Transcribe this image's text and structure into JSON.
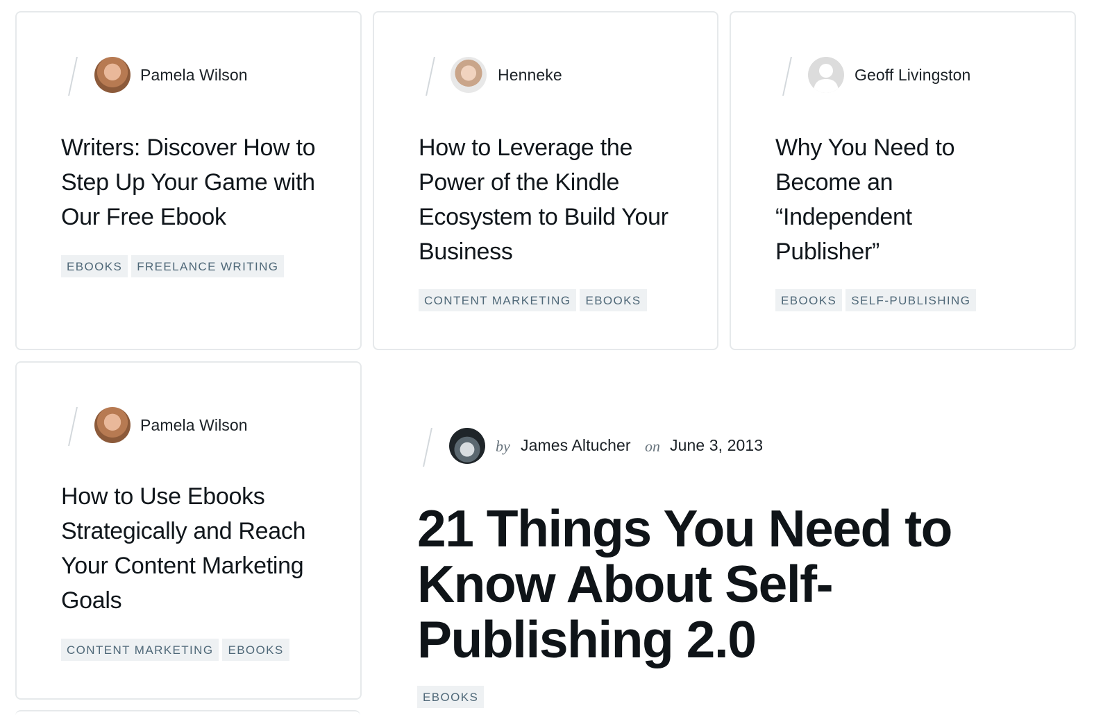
{
  "cards": [
    {
      "author": "Pamela Wilson",
      "title": "Writers: Discover How to Step Up Your Game with Our Free Ebook",
      "tags": [
        "EBOOKS",
        "FREELANCE WRITING"
      ]
    },
    {
      "author": "Henneke",
      "title": "How to Leverage the Power of the Kindle Ecosystem to Build Your Business",
      "tags": [
        "CONTENT MARKETING",
        "EBOOKS"
      ]
    },
    {
      "author": "Geoff Livingston",
      "title": "Why You Need to Become an “Independent Publisher”",
      "tags": [
        "EBOOKS",
        "SELF-PUBLISHING"
      ]
    },
    {
      "author": "Pamela Wilson",
      "title": "How to Use Ebooks Strategically and Reach Your Content Marketing Goals",
      "tags": [
        "CONTENT MARKETING",
        "EBOOKS"
      ]
    }
  ],
  "featured": {
    "by_label": "by",
    "author": "James Altucher",
    "on_label": "on",
    "date": "June 3, 2013",
    "title": "21 Things You Need to Know About Self-Publishing 2.0",
    "tags": [
      "EBOOKS"
    ]
  },
  "icons": {
    "avatar_placeholder": "user-silhouette-icon"
  }
}
